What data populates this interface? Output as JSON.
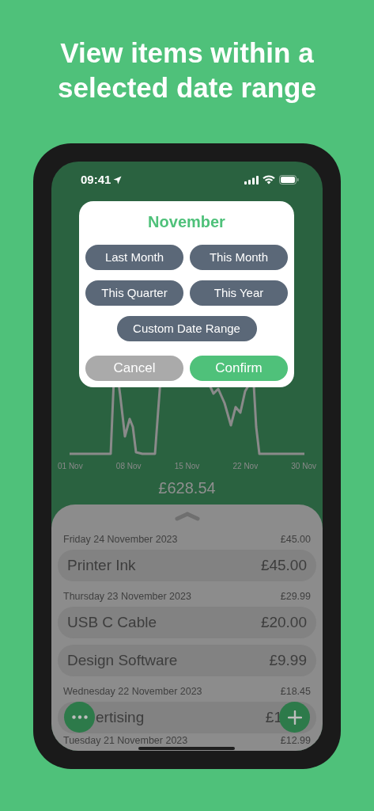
{
  "headline": "View items within a selected date range",
  "status_bar": {
    "time": "09:41"
  },
  "dialog": {
    "title": "November",
    "ranges": [
      "Last Month",
      "This Month",
      "This Quarter",
      "This Year",
      "Custom Date Range"
    ],
    "buttons": [
      {
        "label": "Cancel",
        "kind": "cancel"
      },
      {
        "label": "Confirm",
        "kind": "confirm"
      }
    ]
  },
  "chart": {
    "x_labels": [
      "01 Nov",
      "08 Nov",
      "15 Nov",
      "22 Nov",
      "30 Nov"
    ],
    "total": "£628.54"
  },
  "sheet": {
    "groups": [
      {
        "date": "Friday 24 November 2023",
        "total": "£45.00",
        "items": [
          {
            "name": "Printer Ink",
            "amount": "£45.00"
          }
        ]
      },
      {
        "date": "Thursday 23 November 2023",
        "total": "£29.99",
        "items": [
          {
            "name": "USB C Cable",
            "amount": "£20.00"
          },
          {
            "name": "Design Software",
            "amount": "£9.99"
          }
        ]
      },
      {
        "date": "Wednesday 22 November 2023",
        "total": "£18.45",
        "items": [
          {
            "name": "ertising",
            "amount": "£1",
            "covered": true
          }
        ]
      },
      {
        "date": "Tuesday 21 November 2023",
        "total": "£12.99"
      }
    ]
  }
}
